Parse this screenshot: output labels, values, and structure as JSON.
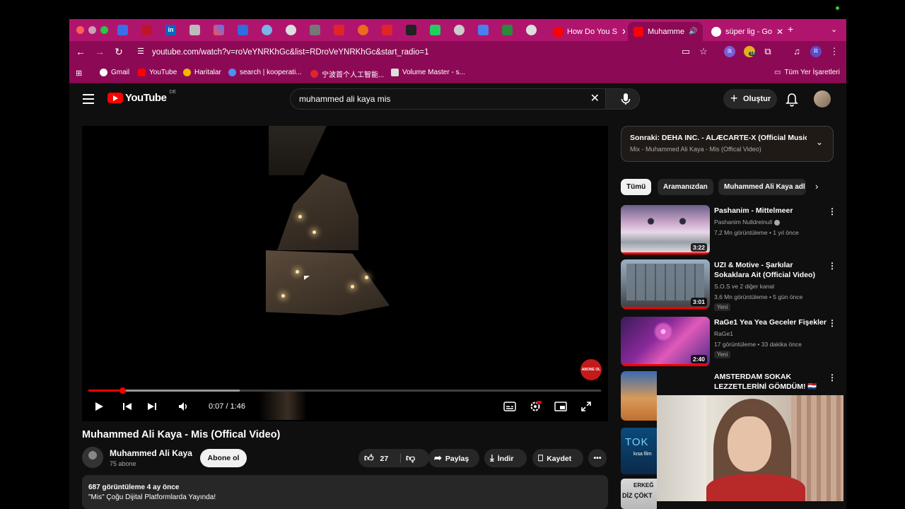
{
  "browser": {
    "tabs": [
      {
        "label": "How Do You S",
        "active": false
      },
      {
        "label": "Muhamme",
        "active": true
      },
      {
        "label": "süper lig - Go",
        "active": false
      }
    ],
    "url": "youtube.com/watch?v=roVeYNRKhGc&list=RDroVeYNRKhGc&start_radio=1",
    "bookmarks": [
      "Gmail",
      "YouTube",
      "Haritalar",
      "search | kooperati...",
      "宁波首个人工智能...",
      "Volume Master - s..."
    ],
    "all_bookmarks": "Tüm Yer İşaretleri",
    "ext_badge": "18",
    "profile_initial": "R"
  },
  "youtube": {
    "logo_text": "YouTube",
    "country_code": "DE",
    "search_value": "muhammed ali kaya mis",
    "create_label": "Oluştur"
  },
  "player": {
    "time": "0:07 / 1:46",
    "progress_fraction": 0.066,
    "buffered_fraction": 0.295,
    "watermark": "ABONE OL"
  },
  "video": {
    "title": "Muhammed Ali Kaya - Mis (Offical Video)",
    "channel": "Muhammed Ali Kaya",
    "subscribers": "75 abone",
    "subscribe_label": "Abone ol",
    "likes": "27",
    "share_label": "Paylaş",
    "download_label": "İndir",
    "save_label": "Kaydet",
    "views_date": "687 görüntüleme  4 ay önce",
    "description": "\"Mis\" Çoğu Dijital Platformlarda Yayında!"
  },
  "sidebar": {
    "upnext_title": "Sonraki: DEHA INC. - ALÆCARTE-X (Official Music ...",
    "upnext_sub": "Mix - Muhammed Ali Kaya - Mis (Offical Video)",
    "chips": [
      "Tümü",
      "Aramanızdan",
      "Muhammed Ali Kaya adl"
    ],
    "recs": [
      {
        "title": "Pashanim - Mittelmeer",
        "channel": "Pashanim Nulldreinull",
        "meta": "7,2 Mn görüntüleme • 1 yıl önce",
        "duration": "3:22"
      },
      {
        "title": "UZI & Motive - Şarkılar Sokaklara Ait (Official Video)",
        "channel": "S.O.S ve 2 diğer kanal",
        "meta": "3,6 Mn görüntüleme • 5 gün önce",
        "badge": "Yeni",
        "duration": "3:01"
      },
      {
        "title": "RaGe1 Yea Yea Geceler Fişekler",
        "channel": "RaGe1",
        "meta": "17 görüntüleme • 33 dakika önce",
        "badge": "Yeni",
        "duration": "2:40"
      },
      {
        "title": "AMSTERDAM SOKAK LEZZETLERİNİ GÖMDÜM! 🇳🇱"
      }
    ],
    "partial_thumbs": [
      "TOK",
      "kısa film",
      "ERKEĞ",
      "DİZ ÇÖKT"
    ]
  }
}
